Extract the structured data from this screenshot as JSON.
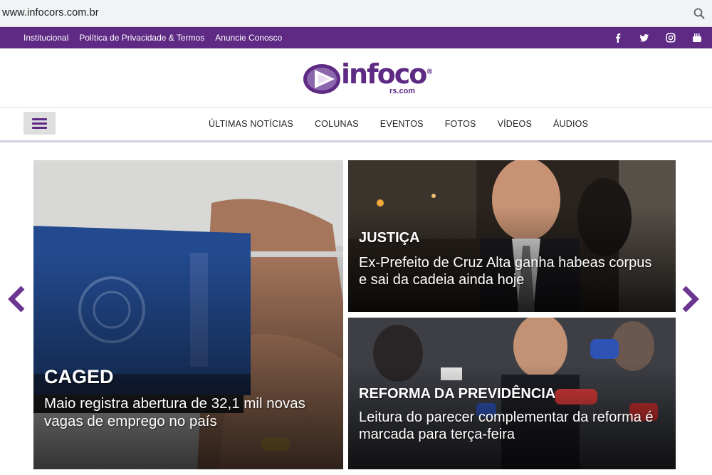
{
  "browser": {
    "url": "www.infocors.com.br"
  },
  "topbar": {
    "links": [
      "Institucional",
      "Política de Privacidade & Termos",
      "Anuncie Conosco"
    ],
    "social": [
      "facebook-icon",
      "twitter-icon",
      "instagram-icon",
      "youtube-icon"
    ]
  },
  "logo": {
    "brand": "infoco",
    "reg": "®",
    "sub": "rs.com"
  },
  "nav": {
    "items": [
      "ÚLTIMAS NOTÍCIAS",
      "COLUNAS",
      "EVENTOS",
      "FOTOS",
      "VÍDEOS",
      "ÁUDIOS"
    ]
  },
  "slides": [
    {
      "category": "CAGED",
      "title": "Maio registra abertura de 32,1 mil novas vagas de emprego no país"
    },
    {
      "category": "JUSTIÇA",
      "title": "Ex-Prefeito de Cruz Alta ganha habeas corpus e sai da cadeia ainda hoje"
    },
    {
      "category": "REFORMA DA PREVIDÊNCIA",
      "title": "Leitura do parecer complementar da reforma é marcada para terça-feira"
    }
  ],
  "colors": {
    "brand": "#5e2a84",
    "nav_border": "#d7cde3"
  }
}
